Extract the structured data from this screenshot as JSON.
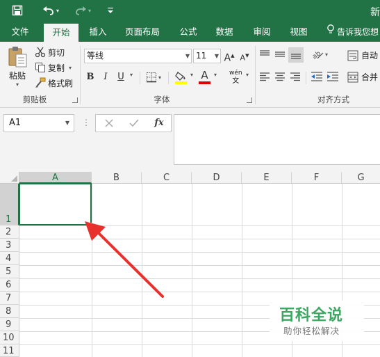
{
  "title_bar": {
    "title_fragment": "新",
    "quick_access": {
      "save_icon": "save-icon",
      "undo_icon": "undo-icon",
      "redo_icon": "redo-icon",
      "customize_icon": "customize-quick-access-icon"
    }
  },
  "ribbon_tabs": [
    {
      "label": "文件",
      "active": false
    },
    {
      "label": "开始",
      "active": true
    },
    {
      "label": "插入",
      "active": false
    },
    {
      "label": "页面布局",
      "active": false
    },
    {
      "label": "公式",
      "active": false
    },
    {
      "label": "数据",
      "active": false
    },
    {
      "label": "审阅",
      "active": false
    },
    {
      "label": "视图",
      "active": false
    }
  ],
  "tell_me": {
    "text": "告诉我您想",
    "icon": "lightbulb-icon"
  },
  "clipboard_group": {
    "label": "剪贴板",
    "paste_label": "粘贴",
    "cut_label": "剪切",
    "copy_label": "复制",
    "format_painter_label": "格式刷"
  },
  "font_group": {
    "label": "字体",
    "font_name": "等线",
    "font_size": "11",
    "grow_label": "A",
    "shrink_label": "A",
    "bold_label": "B",
    "italic_label": "I",
    "underline_label": "U",
    "font_color_label": "A",
    "phonetic_label": "wén",
    "highlight_color": "#ffff00",
    "font_color": "#e00000"
  },
  "alignment_group": {
    "label": "对齐方式",
    "wrap_text_label": "自动",
    "merge_label": "合并"
  },
  "formula_bar": {
    "name_box": "A1",
    "cancel_icon": "cancel-icon",
    "enter_icon": "checkmark-icon",
    "fx_label": "fx",
    "formula": ""
  },
  "grid": {
    "columns": [
      "A",
      "B",
      "C",
      "D",
      "E",
      "F",
      "G"
    ],
    "rows": [
      "1",
      "2",
      "3",
      "4",
      "5",
      "6",
      "7",
      "8",
      "9",
      "10",
      "11"
    ],
    "selected_cell": "A1"
  },
  "watermark": {
    "title": "百科全说",
    "subtitle": "助你轻松解决"
  },
  "colors": {
    "excel_green": "#217346",
    "ribbon_bg": "#f3f3f3",
    "arrow_red": "#e8302c",
    "watermark_green": "#3aa860"
  }
}
